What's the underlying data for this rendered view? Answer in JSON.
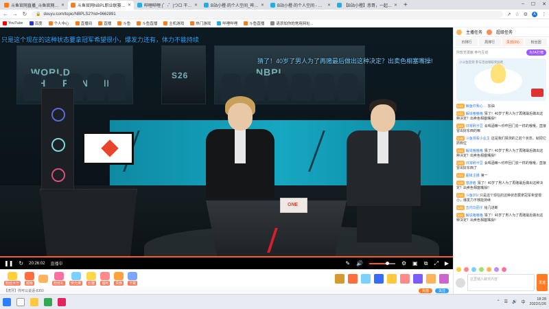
{
  "browser": {
    "tabs": [
      {
        "title": "斗鱼官网直播_斗鱼官网直播视频在",
        "color": "#ff7a1a",
        "active": false
      },
      {
        "title": "斗鱼官网NBPL职业联赛S26",
        "color": "#ff7a1a",
        "active": true
      },
      {
        "title": "哔哩哔哩 (゜-゜)つロ 干杯~-bili",
        "color": "#23ade5",
        "active": false
      },
      {
        "title": "B站小橙·的个人空间_哔哩哔哩_B",
        "color": "#23ade5",
        "active": false
      },
      {
        "title": "B站小橙·的个人空间 - 哔哩哔哩",
        "color": "#23ade5",
        "active": false
      },
      {
        "title": "【B站小橙】悲哥，一起玩转游戏",
        "color": "#23ade5",
        "active": false
      }
    ],
    "new_tab": "+",
    "url": "douyu.com/topic/NBPLS2?rid=9662891",
    "bookmarks": [
      {
        "label": "YouTube",
        "color": "#ff0000"
      },
      {
        "label": "百度",
        "color": "#2932e1"
      },
      {
        "label": "个人中心",
        "color": "#ff7a1a"
      },
      {
        "label": "直播间",
        "color": "#ff7a1a"
      },
      {
        "label": "直播",
        "color": "#ff7a1a"
      },
      {
        "label": "斗鱼",
        "color": "#ff7a1a"
      },
      {
        "label": "斗鱼直播",
        "color": "#ff7a1a"
      },
      {
        "label": "主机游戏",
        "color": "#ff7a1a"
      },
      {
        "label": "热门游戏",
        "color": "#ff7a1a"
      },
      {
        "label": "哔哩哔哩",
        "color": "#23ade5"
      },
      {
        "label": "斗鱼直播",
        "color": "#ff7a1a"
      },
      {
        "label": "请添加你的常用网址...",
        "color": "#888888"
      }
    ]
  },
  "video": {
    "danmaku": [
      {
        "text": "只是这个现在的这种状态要拿冠军希望很小，爆发力还有，体力不能持续"
      },
      {
        "text": "猜了！40岁了男人为了再赌最后做出这种决定？出卖色相塞嘴操!"
      }
    ],
    "screen_text": [
      "WORLD CHAMPIONSHIP",
      "S26",
      "NBPL"
    ],
    "monitor_brand": "ONE"
  },
  "player": {
    "play_icon": "pause",
    "time": "20:26:02",
    "status": "直播中"
  },
  "gifts": [
    {
      "label": "粉丝大厅",
      "color": "#ffcf3d"
    },
    {
      "label": "超级",
      "color": "#ff6f3d"
    },
    {
      "label": "",
      "color": "#ffb35c"
    },
    {
      "label": "粉丝礼",
      "color": "#ff6fa0"
    },
    {
      "label": "荧光棒",
      "color": "#7ad0ff"
    },
    {
      "label": "应援",
      "color": "#ffd84a"
    },
    {
      "label": "福利",
      "color": "#ff8a8a"
    },
    {
      "label": "贵族",
      "color": "#ffa23d"
    },
    {
      "label": "下载",
      "color": "#7aa6ff"
    }
  ],
  "gift_slots": [
    "#d49a30",
    "#ff6f3d",
    "#7ad0ff",
    "#3a6bff",
    "#ffc83d",
    "#ff8a8a",
    "#7a5cff",
    "#ffb35c",
    "#cc66cc"
  ],
  "info": {
    "left": "【虎牙】你可以说话-8350",
    "btn1": "充值",
    "btn2": "关注"
  },
  "sidebar": {
    "header": [
      "主播任务",
      "超级任务"
    ],
    "tabs": [
      "日排行",
      "周排行",
      "贵宾(99)",
      "粉丝团"
    ],
    "rank_text": "你暂无贡献 参与互动",
    "rank_button": "为TA打榜",
    "banner_tip": "小斗鱼签到 参与活动领取奖励吧",
    "messages": [
      {
        "lv": "LV1",
        "name": "鲸鱼你我心…",
        "text": "加油"
      },
      {
        "lv": "LV4",
        "name": "解说嗑嗑嗑",
        "text": "猜了！40岁了男人为了再赌最后做出这种决定？出卖色相塞嘴操!!"
      },
      {
        "lv": "LV3",
        "name": "日常刷卡豆",
        "text": "会喝酒嘛～你咋回门去一样的哦哦，直接冒出好东西的嘛"
      },
      {
        "lv": "LV5",
        "name": "斗鱼观看小业主",
        "text": "这是我们猜测的之前个状态，就把它抓到位"
      },
      {
        "lv": "LV4",
        "name": "解说嗑嗑嗑",
        "text": "猜了！40岁了男人为了再赌最后做出这种决定？出卖色相塞嘴操!!"
      },
      {
        "lv": "LV3",
        "name": "日常刷卡豆",
        "text": "会喝酒嘛～你咋回门去一样的哦哦，直接冒出好东西了"
      },
      {
        "lv": "LV1",
        "name": "超级主播",
        "text": "第一"
      },
      {
        "lv": "LV5",
        "name": "悠游者",
        "text": "猜了！40岁了男人为了再赌最后做出这种决定？出卖色相塞嘴操!!"
      },
      {
        "lv": "LV4",
        "name": "斗鱼DSI",
        "text": "只是这个现在的这种状态要拿冠军希望很小，爆发力不够能持续"
      },
      {
        "lv": "LV2",
        "name": "五内鸟团子",
        "text": "给几进断"
      },
      {
        "lv": "LV4",
        "name": "解说嗑嗑嗑",
        "text": "猜了！40岁了男人为了再赌最后做出这种决定？出卖色相塞嘴操!!"
      }
    ],
    "emoji_colors": [
      "#ffcf3d",
      "#ff8a8a",
      "#7ad0ff",
      "#a0e070",
      "#ffb35c",
      "#c48aff",
      "#ff6fa0"
    ],
    "input_placeholder": "这里输入聊天内容",
    "send": "发送"
  },
  "taskbar": {
    "apps": [
      {
        "name": "windows-icon",
        "color": "#2b7fff"
      },
      {
        "name": "search-icon",
        "color": "#ffffff"
      },
      {
        "name": "file-explorer-icon",
        "color": "#ffc83d"
      },
      {
        "name": "chrome-icon",
        "color": "#34a853"
      },
      {
        "name": "app-icon",
        "color": "#e0245e"
      }
    ],
    "lang": "中",
    "time": "18:28",
    "date": "2022/1/26"
  }
}
